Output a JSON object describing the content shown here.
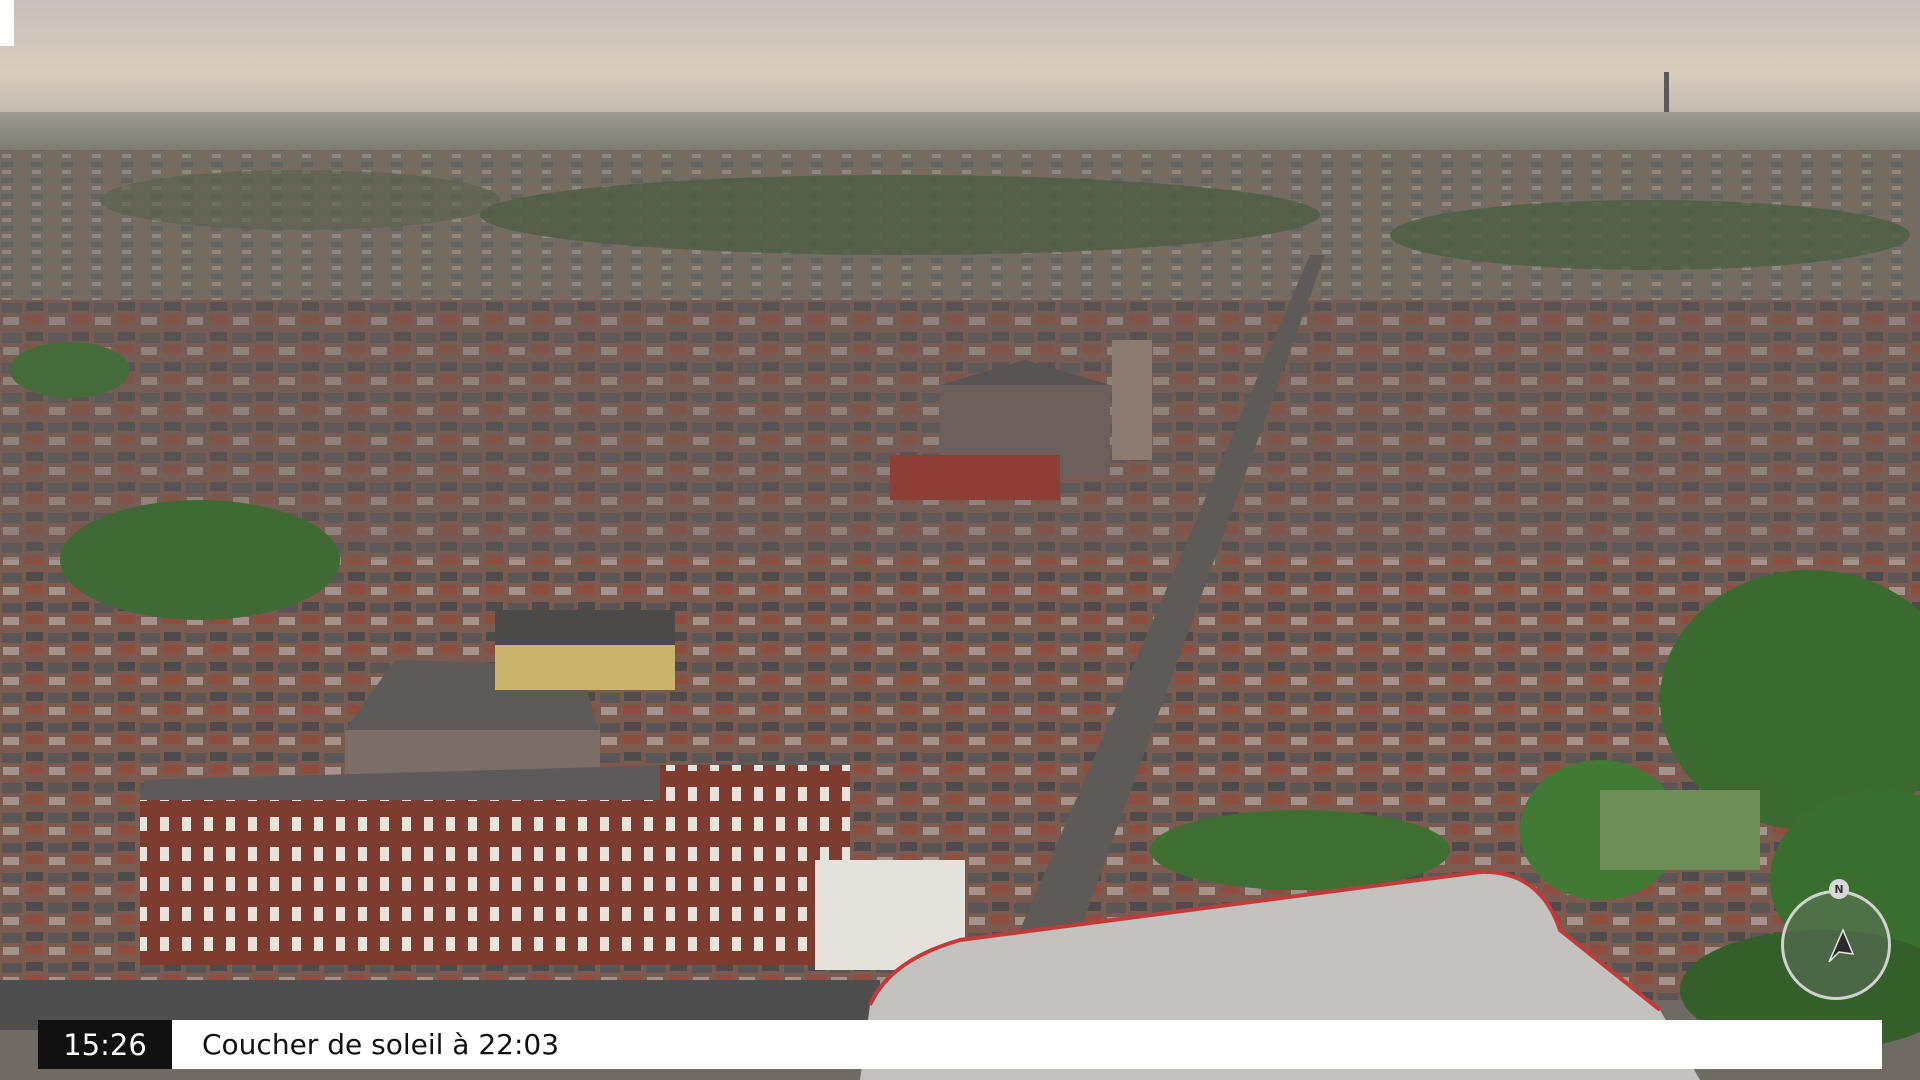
{
  "overlay": {
    "time": "15:26",
    "sunset_text": "Coucher de soleil à 22:03"
  },
  "compass": {
    "north_label": "N",
    "icon": "compass-icon"
  },
  "scene": {
    "description_icon": "aerial-city-view",
    "sky_color": "#cfc6bd",
    "roof_color": "#5a5656",
    "brick_color": "#8a4a3c",
    "tree_color": "#3f6a35"
  }
}
